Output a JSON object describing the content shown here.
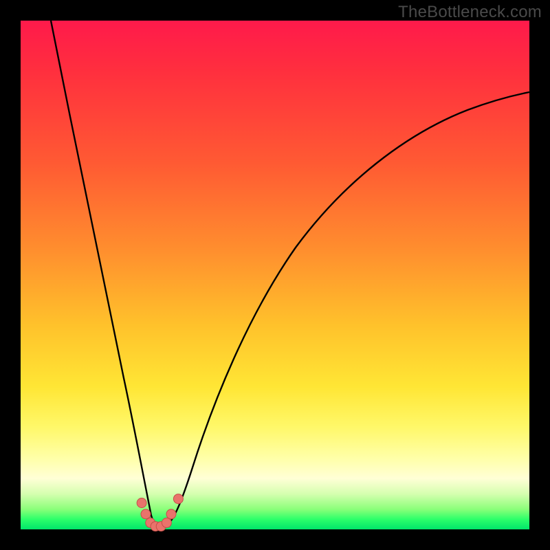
{
  "watermark": "TheBottleneck.com",
  "colors": {
    "frame": "#000000",
    "gradient_top": "#ff1a4b",
    "gradient_mid1": "#ff8e2e",
    "gradient_mid2": "#ffe635",
    "gradient_pale": "#ffffd6",
    "gradient_bottom": "#00e66a",
    "curve": "#000000",
    "marker_fill": "#e9736b",
    "marker_stroke": "#c44e49"
  },
  "chart_data": {
    "type": "line",
    "title": "",
    "xlabel": "",
    "ylabel": "",
    "xlim": [
      0,
      100
    ],
    "ylim": [
      0,
      100
    ],
    "series": [
      {
        "name": "left-branch",
        "x": [
          6,
          8,
          10,
          12,
          14,
          16,
          18,
          20,
          21,
          22,
          23,
          24,
          25,
          26
        ],
        "y": [
          100,
          88,
          76,
          64,
          53,
          42,
          32,
          22,
          17,
          13,
          9,
          6,
          3,
          1
        ]
      },
      {
        "name": "right-branch",
        "x": [
          28,
          30,
          32,
          35,
          40,
          45,
          50,
          55,
          60,
          65,
          70,
          75,
          80,
          85,
          90,
          95,
          100
        ],
        "y": [
          1,
          4,
          9,
          17,
          29,
          39,
          47,
          54,
          60,
          65,
          69,
          73,
          76,
          79,
          81,
          83,
          85
        ]
      }
    ],
    "trough": {
      "x_range": [
        24,
        30
      ],
      "y": 0.5
    },
    "markers": [
      {
        "x": 23.8,
        "y": 5.2
      },
      {
        "x": 24.6,
        "y": 3.0
      },
      {
        "x": 25.5,
        "y": 1.3
      },
      {
        "x": 26.5,
        "y": 0.6
      },
      {
        "x": 27.6,
        "y": 0.6
      },
      {
        "x": 28.7,
        "y": 1.3
      },
      {
        "x": 29.6,
        "y": 3.0
      },
      {
        "x": 31.0,
        "y": 6.0
      }
    ]
  }
}
